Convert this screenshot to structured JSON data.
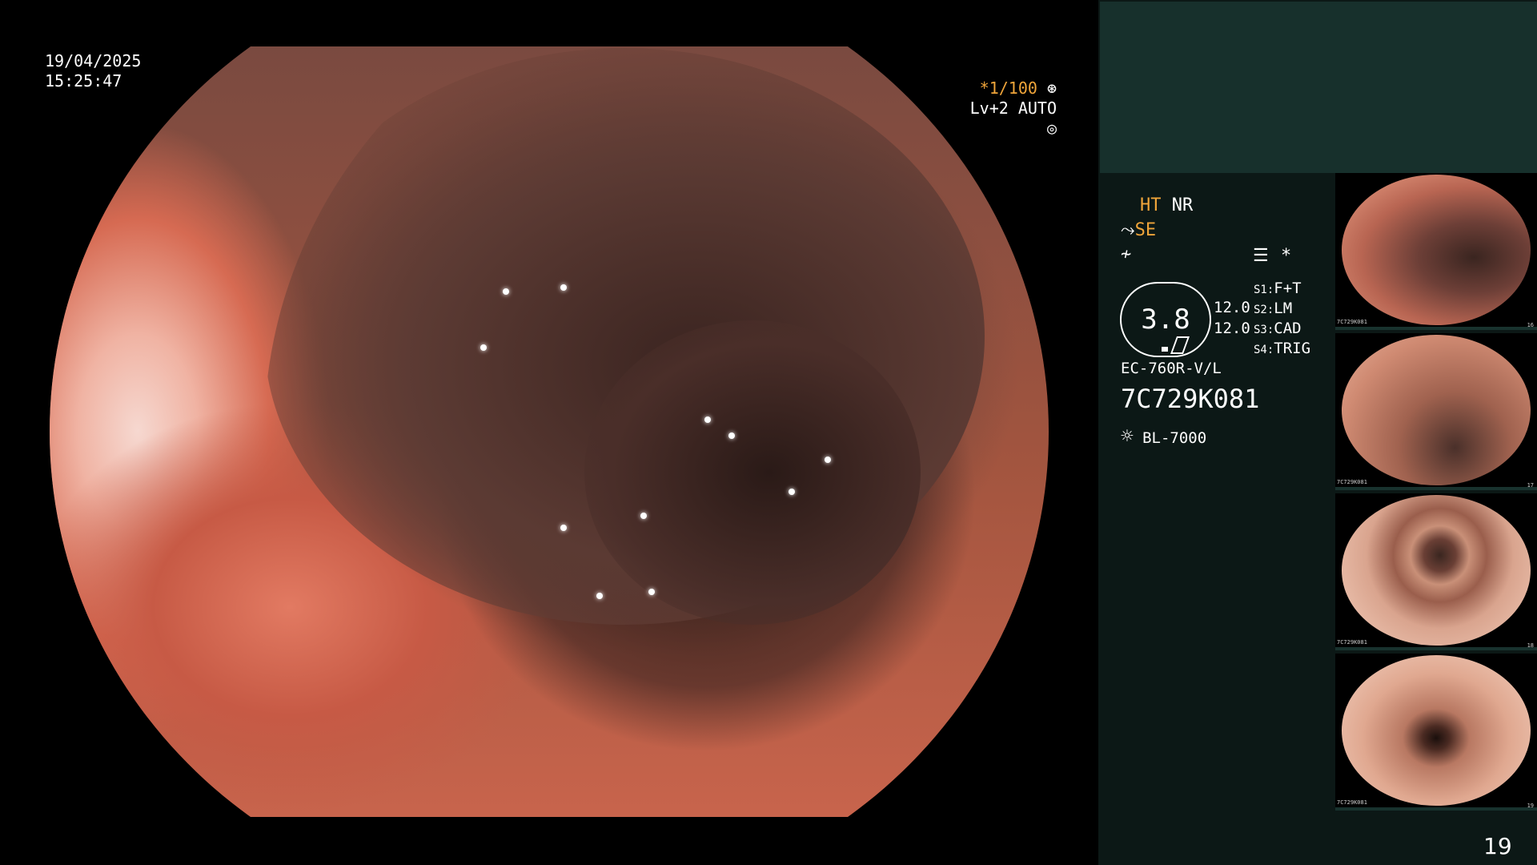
{
  "overlay": {
    "date": "19/04/2025",
    "time": "15:25:47",
    "shutter": "*1/100",
    "shutter_icon": "aperture-icon",
    "level": "Lv+2 AUTO",
    "level_icon": "iris-icon"
  },
  "side": {
    "ht": "HT",
    "nr": "NR",
    "se": "SE",
    "se_icon": "structure-enhance-icon",
    "f_icon": "filter-icon",
    "menu_icon": "settings-list-icon",
    "star": "*",
    "gauge_value": "3.8",
    "value_top": "12.0",
    "value_bottom": "12.0",
    "s1_label": "S1:",
    "s1_value": "F+T",
    "s2_label": "S2:",
    "s2_value": "LM",
    "s3_label": "S3:",
    "s3_value": "CAD",
    "s4_label": "S4:",
    "s4_value": "TRIG",
    "scope_model": "EC-760R-V/L",
    "serial": "7C729K081",
    "light_icon": "light-source-icon",
    "light_source": "BL-7000"
  },
  "thumbnails": [
    {
      "caption": "7C729K081",
      "num": "16"
    },
    {
      "caption": "7C729K081",
      "num": "17"
    },
    {
      "caption": "7C729K081",
      "num": "18"
    },
    {
      "caption": "7C729K081",
      "num": "19"
    }
  ],
  "page_number": "19"
}
